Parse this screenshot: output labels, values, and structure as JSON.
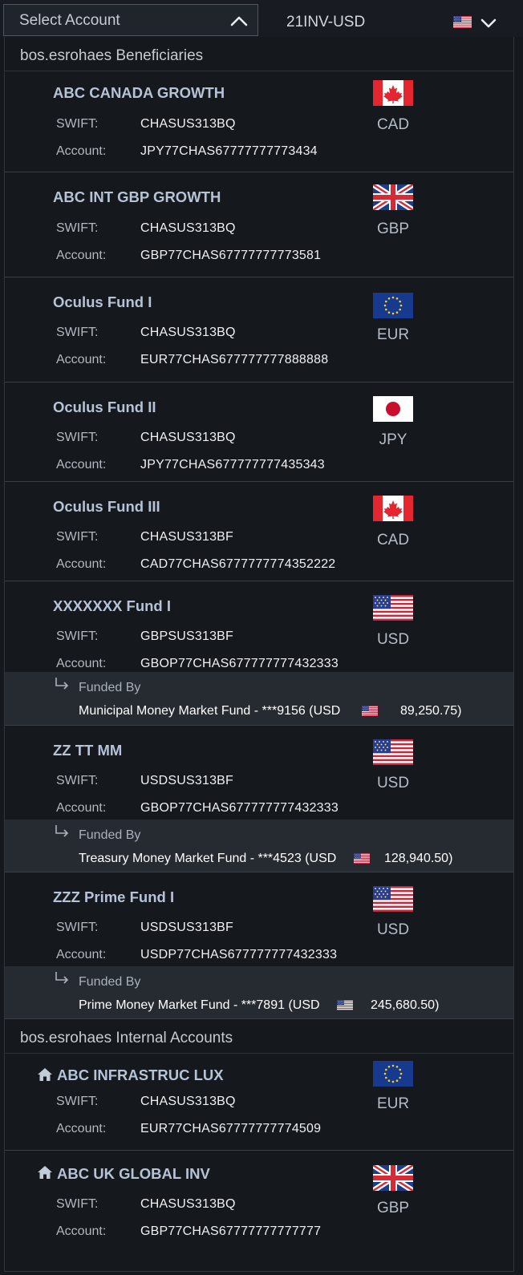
{
  "header": {
    "select_label": "Select Account",
    "account_selected": "21INV-USD"
  },
  "sections": {
    "beneficiaries_title": "bos.esrohaes Beneficiaries",
    "internal_title": "bos.esrohaes Internal Accounts"
  },
  "labels": {
    "swift": "SWIFT:",
    "account": "Account:",
    "funded_by": "Funded By"
  },
  "beneficiaries": [
    {
      "name": "ABC CANADA GROWTH",
      "swift": "CHASUS313BQ",
      "account": "JPY77CHAS67777777773434",
      "currency": "CAD",
      "flag": "canada-flag-icon"
    },
    {
      "name": "ABC INT GBP GROWTH",
      "swift": "CHASUS313BQ",
      "account": "GBP77CHAS67777777773581",
      "currency": "GBP",
      "flag": "uk-flag-icon"
    },
    {
      "name": "Oculus Fund I",
      "swift": "CHASUS313BQ",
      "account": "EUR77CHAS677777777888888",
      "currency": "EUR",
      "flag": "eu-flag-icon"
    },
    {
      "name": "Oculus Fund II",
      "swift": "CHASUS313BQ",
      "account": "JPY77CHAS677777777435343",
      "currency": "JPY",
      "flag": "japan-flag-icon"
    },
    {
      "name": "Oculus Fund III",
      "swift": "CHASUS313BF",
      "account": "CAD77CHAS6777777774352222",
      "currency": "CAD",
      "flag": "canada-flag-icon"
    },
    {
      "name": "XXXXXXX Fund I",
      "swift": "GBPSUS313BF",
      "account": "GBOP77CHAS677777777432333",
      "currency": "USD",
      "flag": "us-flag-icon",
      "funded_fund": "Municipal Money Market Fund - ***9156 (USD",
      "funded_amount": "89,250.75)"
    },
    {
      "name": "ZZ TT MM",
      "swift": "USDSUS313BF",
      "account": "GBOP77CHAS677777777432333",
      "currency": "USD",
      "flag": "us-flag-icon",
      "funded_fund": "Treasury Money Market Fund - ***4523 (USD",
      "funded_amount": "128,940.50)"
    },
    {
      "name": "ZZZ Prime Fund I",
      "swift": "USDSUS313BF",
      "account": "USDP77CHAS677777777432333",
      "currency": "USD",
      "flag": "us-flag-icon",
      "funded_fund": "Prime Money Market Fund - ***7891 (USD",
      "funded_amount": "245,680.50)"
    }
  ],
  "internal": [
    {
      "name": "ABC INFRASTRUC LUX",
      "swift": "CHASUS313BQ",
      "account": "EUR77CHAS67777777774509",
      "currency": "EUR",
      "flag": "eu-flag-icon"
    },
    {
      "name": "ABC UK GLOBAL INV",
      "swift": "CHASUS313BQ",
      "account": "GBP77CHAS67777777777777",
      "currency": "GBP",
      "flag": "uk-flag-icon"
    }
  ],
  "colors": {
    "background": "#15181d",
    "funded_bg": "#262a31",
    "name_text": "#b6c3d6"
  }
}
